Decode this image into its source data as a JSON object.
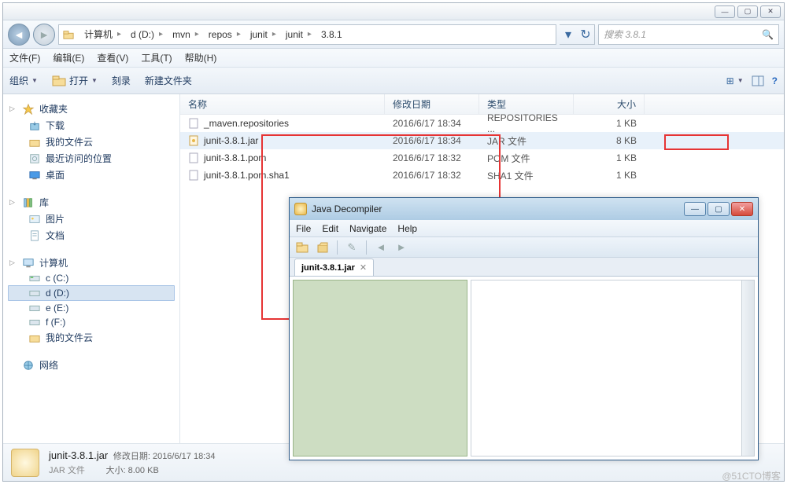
{
  "window": {
    "min": "—",
    "max": "▢",
    "close": "✕"
  },
  "nav": {
    "back": "◄",
    "fwd": "►",
    "crumbs": [
      "计算机",
      "d (D:)",
      "mvn",
      "repos",
      "junit",
      "junit",
      "3.8.1"
    ],
    "refresh": "↻",
    "search_placeholder": "搜索 3.8.1"
  },
  "menubar": [
    "文件(F)",
    "编辑(E)",
    "查看(V)",
    "工具(T)",
    "帮助(H)"
  ],
  "toolbar": {
    "organize": "组织",
    "open": "打开",
    "burn": "刻录",
    "newfolder": "新建文件夹",
    "view_icon": "☰",
    "help_icon": "?"
  },
  "tree": {
    "fav": {
      "head": "收藏夹",
      "items": [
        "下载",
        "我的文件云",
        "最近访问的位置",
        "桌面"
      ]
    },
    "lib": {
      "head": "库",
      "items": [
        "图片",
        "文档"
      ]
    },
    "comp": {
      "head": "计算机",
      "items": [
        "c (C:)",
        "d (D:)",
        "e (E:)",
        "f (F:)",
        "我的文件云"
      ]
    },
    "net": {
      "head": "网络"
    }
  },
  "columns": {
    "name": "名称",
    "date": "修改日期",
    "type": "类型",
    "size": "大小"
  },
  "files": [
    {
      "name": "_maven.repositories",
      "date": "2016/6/17 18:34",
      "type": "REPOSITORIES ...",
      "size": "1 KB",
      "icon": "file"
    },
    {
      "name": "junit-3.8.1.jar",
      "date": "2016/6/17 18:34",
      "type": "JAR 文件",
      "size": "8 KB",
      "icon": "jar",
      "sel": true
    },
    {
      "name": "junit-3.8.1.pom",
      "date": "2016/6/17 18:32",
      "type": "POM 文件",
      "size": "1 KB",
      "icon": "file"
    },
    {
      "name": "junit-3.8.1.pom.sha1",
      "date": "2016/6/17 18:32",
      "type": "SHA1 文件",
      "size": "1 KB",
      "icon": "file"
    }
  ],
  "jd": {
    "title": "Java Decompiler",
    "menus": [
      "File",
      "Edit",
      "Navigate",
      "Help"
    ],
    "tab": "junit-3.8.1.jar",
    "tab_close": "✕",
    "icons": {
      "open": "📂",
      "open2": "📁",
      "wand": "✎",
      "back": "◄",
      "fwd": "►"
    }
  },
  "status": {
    "filename": "junit-3.8.1.jar",
    "filetype": "JAR 文件",
    "k_date": "修改日期:",
    "v_date": "2016/6/17 18:34",
    "k_size": "大小:",
    "v_size": "8.00 KB"
  },
  "watermark": "@51CTO博客"
}
